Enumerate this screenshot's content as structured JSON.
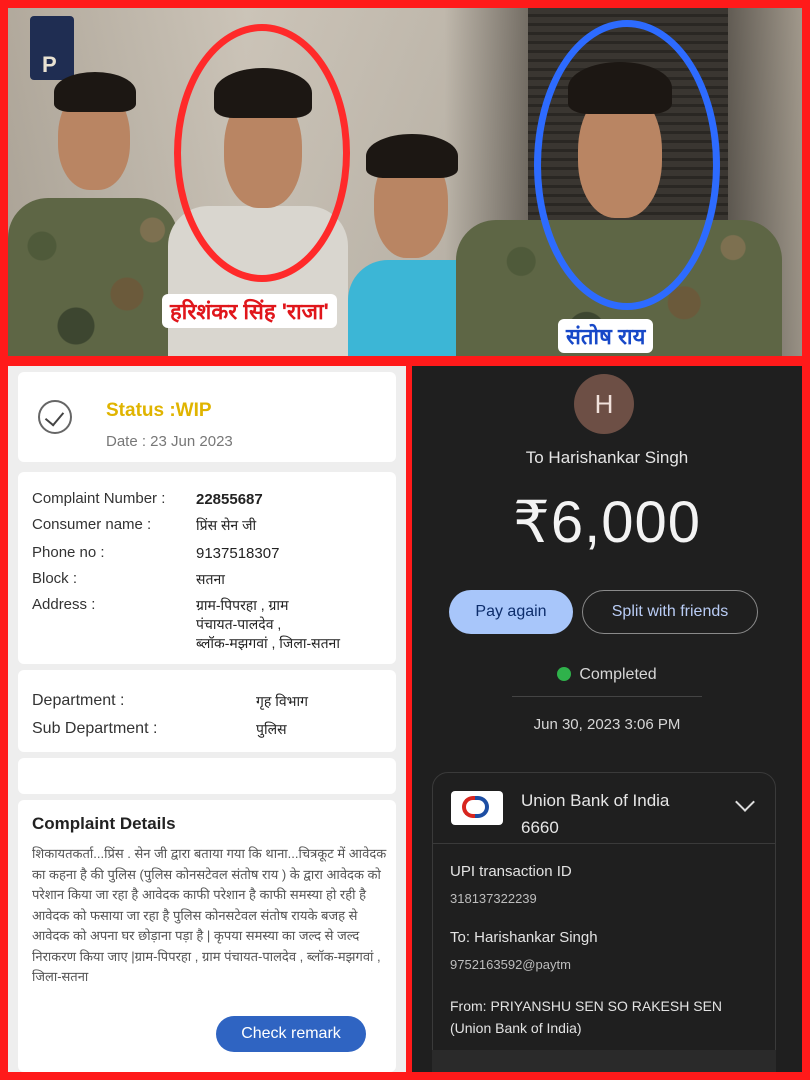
{
  "photo": {
    "badge_letter": "P",
    "label_left": "हरिशंकर सिंह 'राजा'",
    "label_right": "संतोष राय"
  },
  "complaint": {
    "status": "Status :WIP",
    "date": "Date : 23 Jun 2023",
    "rows": [
      {
        "label": "Complaint Number :",
        "value": "22855687"
      },
      {
        "label": "Consumer name :",
        "value": "प्रिंस   सेन जी"
      },
      {
        "label": "Phone no :",
        "value": "9137518307"
      },
      {
        "label": "Block :",
        "value": "सतना"
      },
      {
        "label": "Address :",
        "value_lines": [
          "ग्राम-पिपरहा , ग्राम",
          "पंचायत-पालदेव ,",
          "ब्लॉक-मझगवां , जिला-सतना"
        ]
      }
    ],
    "department_label": "Department :",
    "department_value": "गृह विभाग",
    "sub_department_label": "Sub Department :",
    "sub_department_value": "पुलिस",
    "details_title": "Complaint Details",
    "details_text": "शिकायतकर्ता...प्रिंस . सेन जी  द्वारा बताया गया कि थाना...चित्रकूट में  आवेदक का कहना है की पुलिस (पुलिस  कोनसटेवल संतोष राय ) के द्वारा आवेदक को परेशान  किया जा रहा है आवेदक काफी परेशान है काफी समस्या हो रही है  आवेदक को फसाया जा रहा है  पुलिस  कोनसटेवल संतोष रायके बजह से आवेदक को अपना घर छोड़ाना पड़ा है | कृपया समस्या का जल्द से जल्द निराकरण किया जाए |ग्राम-पिपरहा , ग्राम पंचायत-पालदेव , ब्लॉक-मझगवां , जिला-सतना",
    "remark_button": "Check remark"
  },
  "payment": {
    "avatar_letter": "H",
    "to": "To Harishankar Singh",
    "amount": "₹6,000",
    "pay_again": "Pay again",
    "split": "Split with friends",
    "status": "Completed",
    "datetime": "Jun 30, 2023 3:06 PM",
    "bank_name": "Union Bank of India",
    "bank_account": "6660",
    "upi_label": "UPI transaction ID",
    "upi_id": "318137322239",
    "to_label": "To: Harishankar Singh",
    "to_vpa": "9752163592@paytm",
    "from_line1": "From: PRIYANSHU SEN SO RAKESH SEN",
    "from_line2": "(Union Bank of India)",
    "colors": {
      "completed": "#2fb24b",
      "pay_again_bg": "#a8c6fa",
      "status_wip": "#e0b400"
    }
  }
}
